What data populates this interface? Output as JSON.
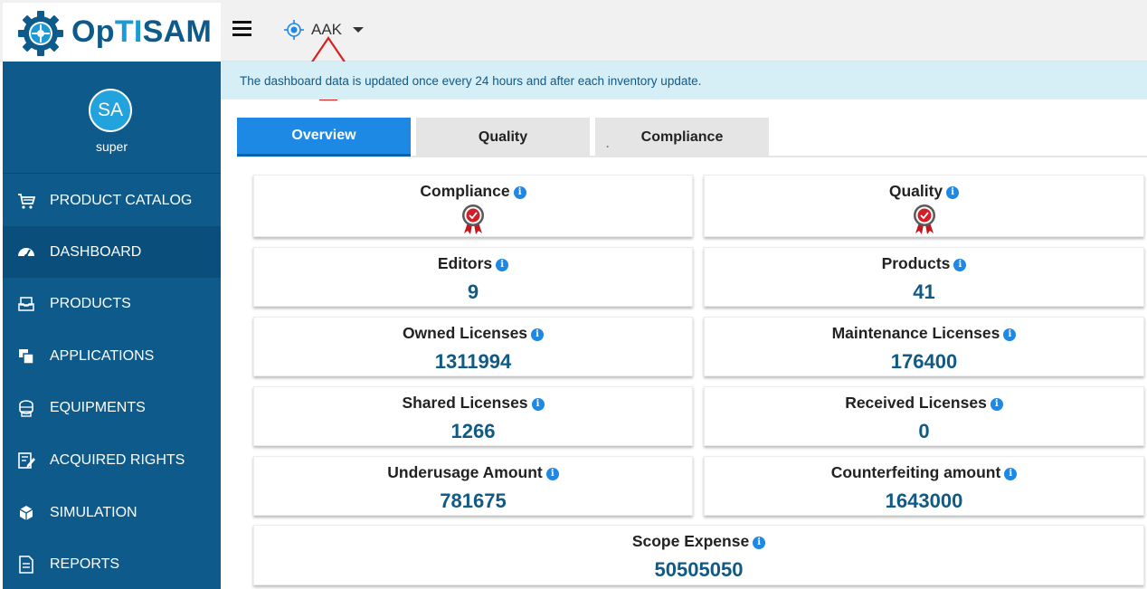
{
  "app": {
    "logo_text_parts": [
      "Op",
      "TI",
      "SAM"
    ],
    "logo_icon": "gear-logo-icon",
    "brand_color": "#0e5a8a",
    "accent_color": "#1a9ad6"
  },
  "header": {
    "menu_icon": "hamburger-menu-icon",
    "scope_icon": "crosshair-target-icon",
    "scope_label": "AAK",
    "scope_caret_icon": "caret-down-icon"
  },
  "user": {
    "initials": "SA",
    "name": "super"
  },
  "sidebar": {
    "items": [
      {
        "label": "PRODUCT CATALOG",
        "icon": "cart-icon",
        "active": false
      },
      {
        "label": "DASHBOARD",
        "icon": "speedometer-icon",
        "active": true
      },
      {
        "label": "PRODUCTS",
        "icon": "inbox-tray-icon",
        "active": false
      },
      {
        "label": "APPLICATIONS",
        "icon": "stacked-windows-icon",
        "active": false
      },
      {
        "label": "EQUIPMENTS",
        "icon": "server-icon",
        "active": false
      },
      {
        "label": "ACQUIRED RIGHTS",
        "icon": "edit-document-icon",
        "active": false
      },
      {
        "label": "SIMULATION",
        "icon": "cube-icon",
        "active": false
      },
      {
        "label": "REPORTS",
        "icon": "report-document-icon",
        "active": false
      }
    ]
  },
  "banner": {
    "text": "The dashboard data is updated once every 24 hours and after each inventory update."
  },
  "tabs": [
    {
      "label": "Overview",
      "active": true
    },
    {
      "label": "Quality",
      "active": false
    },
    {
      "label": "Compliance",
      "active": false,
      "prefix": "."
    }
  ],
  "cards": {
    "compliance": {
      "title": "Compliance",
      "badge_icon": "red-award-badge-icon"
    },
    "quality": {
      "title": "Quality",
      "badge_icon": "red-award-badge-icon"
    },
    "editors": {
      "title": "Editors",
      "value": "9"
    },
    "products": {
      "title": "Products",
      "value": "41"
    },
    "owned_licenses": {
      "title": "Owned Licenses",
      "value": "1311994"
    },
    "maintenance_licenses": {
      "title": "Maintenance Licenses",
      "value": "176400"
    },
    "shared_licenses": {
      "title": "Shared Licenses",
      "value": "1266"
    },
    "received_licenses": {
      "title": "Received Licenses",
      "value": "0"
    },
    "underusage_amount": {
      "title": "Underusage Amount",
      "value": "781675"
    },
    "counterfeiting_amount": {
      "title": "Counterfeiting amount",
      "value": "1643000"
    },
    "scope_expense": {
      "title": "Scope Expense",
      "value": "50505050"
    }
  },
  "info_icon_glyph": "i"
}
